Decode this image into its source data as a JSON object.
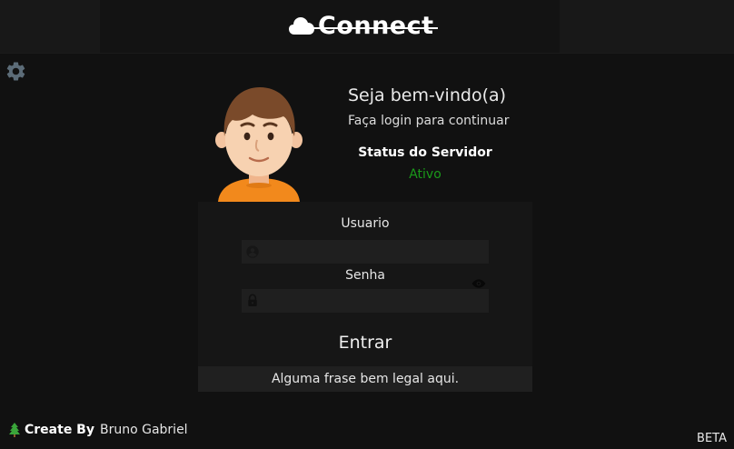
{
  "header": {
    "logo_text": "Connect"
  },
  "settings": {
    "icon": "gear-icon"
  },
  "welcome": {
    "title": "Seja bem-vindo(a)",
    "subtitle": "Faça login para continuar",
    "status_title": "Status do Servidor",
    "status_value": "Ativo",
    "status_color": "#1a9a1a"
  },
  "form": {
    "user_label": "Usuario",
    "user_value": "",
    "password_label": "Senha",
    "password_value": "",
    "submit_label": "Entrar",
    "quote": "Alguma frase bem legal aqui."
  },
  "footer": {
    "credit_prefix": "Create By",
    "credit_name": "Bruno Gabriel",
    "version_badge": "BETA"
  },
  "colors": {
    "background": "#111111",
    "panel": "#161616",
    "field": "#1f1f1f",
    "accent_green": "#1a9a1a"
  }
}
